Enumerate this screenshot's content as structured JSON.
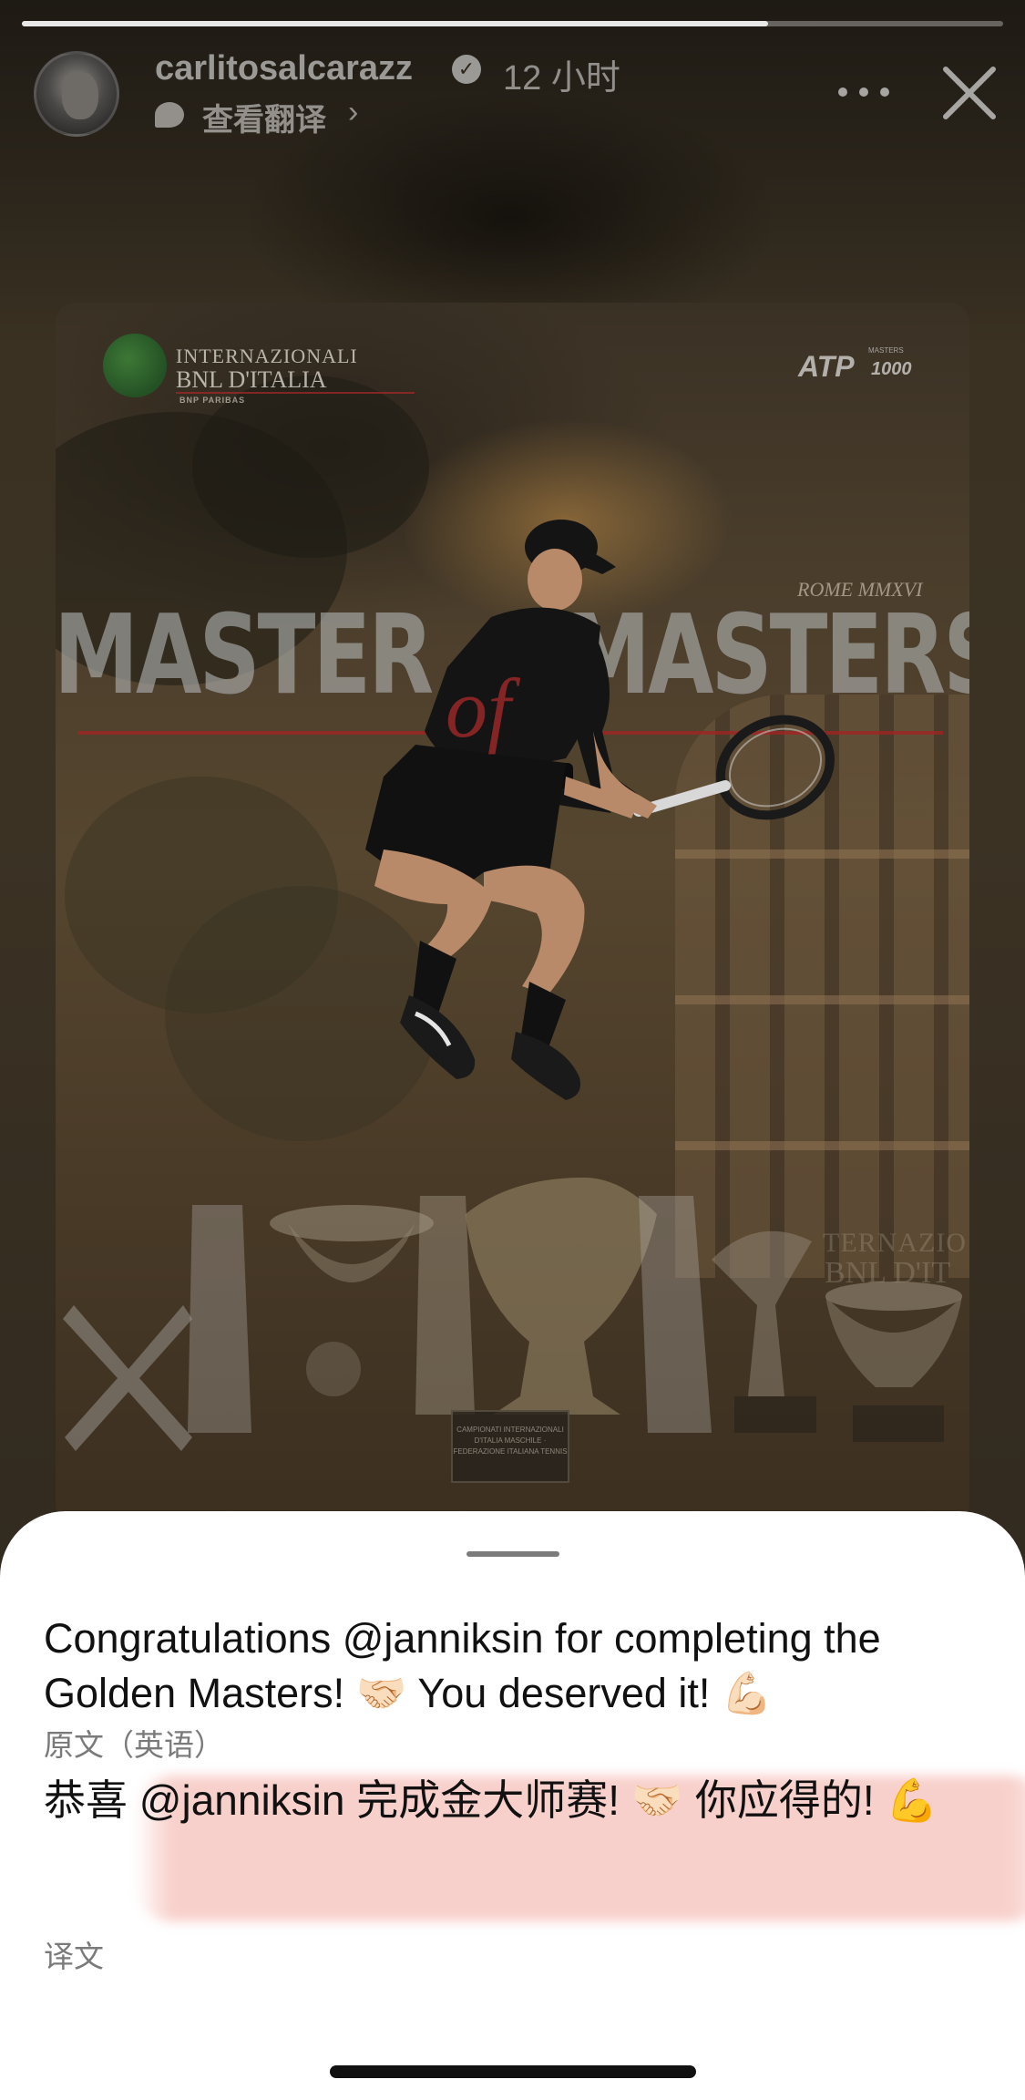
{
  "story": {
    "progress": 0.76,
    "username": "carlitosalcarazz",
    "verified_icon": "check-badge-icon",
    "time": "12 小时",
    "translate_link": "查看翻译",
    "translate_chevron": "›",
    "more_icon": "ellipsis-icon",
    "close_icon": "close-icon"
  },
  "poster": {
    "event_logo": {
      "line1": "INTERNAZIONALI",
      "line2": "BNL D'ITALIA",
      "line3": "BNP PARIBAS"
    },
    "tour_logo": "ATP",
    "tour_logo_sub": "MASTERS",
    "tour_logo_tier": "1000",
    "edition": "ROME MMXVI",
    "headline_left": "MASTER",
    "headline_of": "of",
    "headline_right": "MASTERS",
    "plaque_text": "CAMPIONATI INTERNAZIONALI D'ITALIA MASCHILE · FEDERAZIONE ITALIANA TENNIS",
    "watermark_line1": "TERNAZIO",
    "watermark_line2": "BNL D'IT"
  },
  "sheet": {
    "original_text": "Congratulations @janniksin for completing the Golden Masters! 🤝🏻 You deserved it! 💪🏻",
    "original_label": "原文（英语）",
    "translated_text": "恭喜 @janniksin 完成金大师赛! 🤝🏻 你应得的! 💪",
    "translated_label": "译文"
  },
  "colors": {
    "sheet_bg": "#ffffff",
    "highlight": "#f2aaa0",
    "secondary_text": "#7a7a7a"
  }
}
